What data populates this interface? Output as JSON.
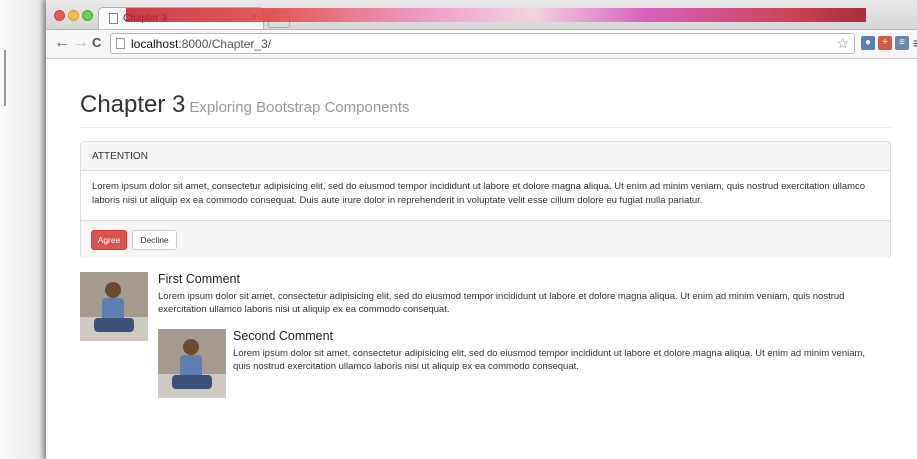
{
  "browser": {
    "tab_title": "Chapter 3",
    "url_host": "localhost",
    "url_path": ":8000/Chapter_3/"
  },
  "page": {
    "title": "Chapter 3",
    "subtitle": "Exploring Bootstrap Components",
    "panel": {
      "heading": "ATTENTION",
      "body": "Lorem ipsum dolor sit amet, consectetur adipisicing elit, sed do eiusmod tempor incididunt ut labore et dolore magna aliqua. Ut enim ad minim veniam, quis nostrud exercitation ullamco laboris nisi ut aliquip ex ea commodo consequat. Duis aute irure dolor in reprehenderit in voluptate velit esse cillum dolore eu fugiat nulla pariatur.",
      "agree_label": "Agree",
      "decline_label": "Decline"
    },
    "comments": [
      {
        "heading": "First Comment",
        "body": "Lorem ipsum dolor sit amet, consectetur adipisicing elit, sed do eiusmod tempor incididunt ut labore et dolore magna aliqua. Ut enim ad minim veniam, quis nostrud exercitation ullamco laboris nisi ut aliquip ex ea commodo consequat."
      },
      {
        "heading": "Second Comment",
        "body": "Lorem ipsum dolor sit amet, consectetur adipisicing elit, sed do eiusmod tempor incididunt ut labore et dolore magna aliqua. Ut enim ad minim veniam, quis nostrud exercitation ullamco laboris nisi ut aliquip ex ea commodo consequat."
      }
    ]
  },
  "colors": {
    "agree_button": "#d9534f",
    "panel_heading_bg": "#f5f5f5",
    "subtitle": "#999999"
  },
  "icons": [
    "back-arrow-icon",
    "forward-arrow-icon",
    "reload-icon",
    "page-icon",
    "bookmark-star-icon",
    "extension-icons"
  ]
}
